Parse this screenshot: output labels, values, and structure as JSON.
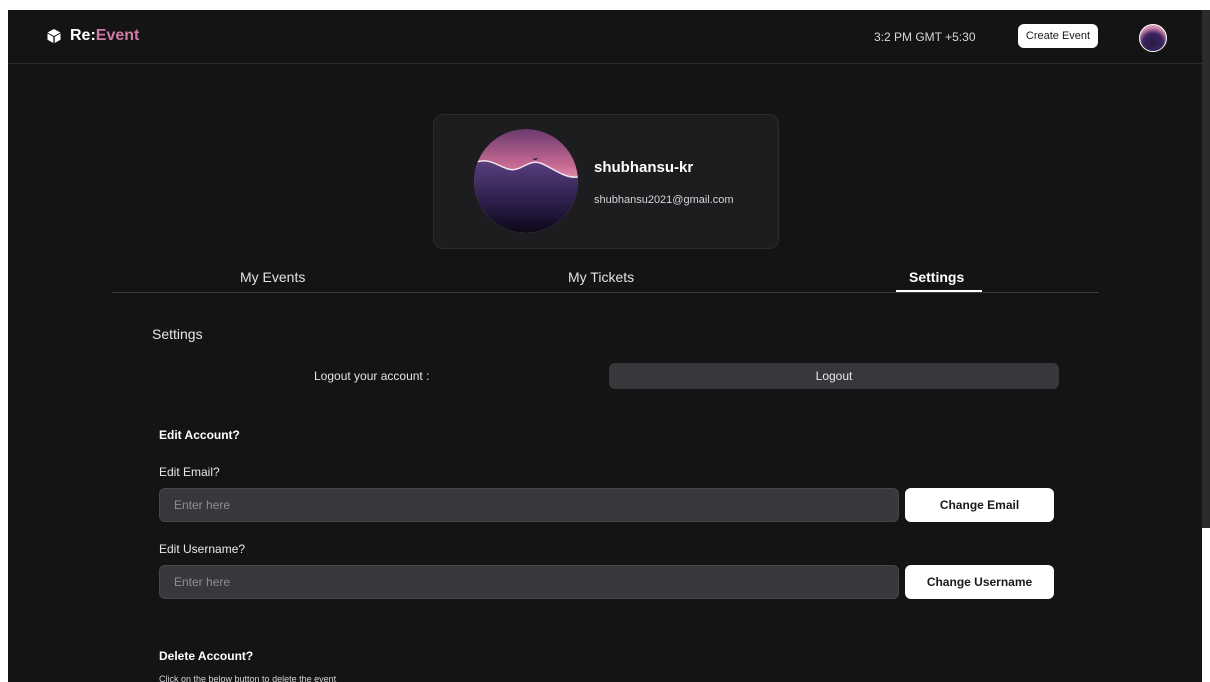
{
  "navbar": {
    "brand_prefix": "Re:",
    "brand_accent": "Event",
    "time": "3:2 PM GMT +5:30",
    "create_label": "Create Event"
  },
  "profile": {
    "username": "shubhansu-kr",
    "email": "shubhansu2021@gmail.com"
  },
  "tabs": [
    {
      "label": "My Events",
      "active": false
    },
    {
      "label": "My Tickets",
      "active": false
    },
    {
      "label": "Settings",
      "active": true
    }
  ],
  "settings": {
    "title": "Settings",
    "logout_label": "Logout your account :",
    "logout_button": "Logout",
    "edit_heading": "Edit Account?",
    "edit_email_label": "Edit Email?",
    "email_placeholder": "Enter here",
    "change_email_button": "Change Email",
    "edit_username_label": "Edit Username?",
    "username_placeholder": "Enter here",
    "change_username_button": "Change Username",
    "delete_heading": "Delete Account?",
    "delete_note": "Click on the below button to delete the event"
  },
  "colors": {
    "background": "#141415",
    "accent": "#d07aa6",
    "card": "#1d1d20",
    "field": "#38383c"
  },
  "icons": {
    "brand": "cube-icon"
  }
}
